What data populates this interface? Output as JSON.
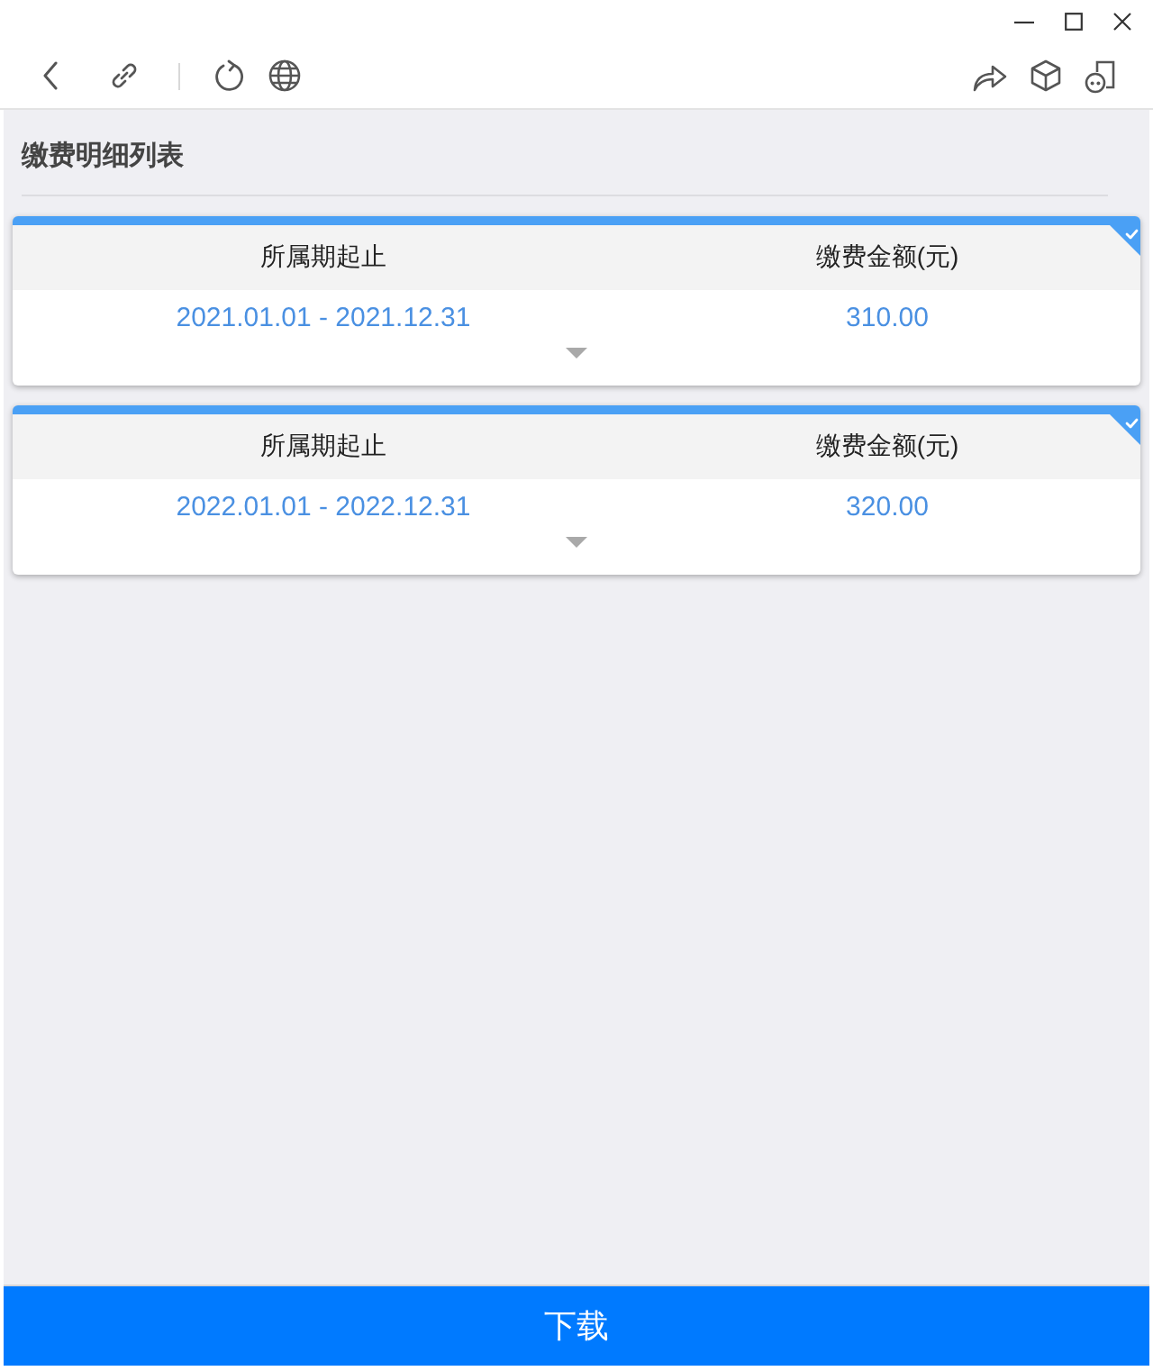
{
  "page_title": "缴费明细列表",
  "records": [
    {
      "selected": true,
      "period_label": "所属期起止",
      "amount_label": "缴费金额(元)",
      "period": "2021.01.01 - 2021.12.31",
      "amount": "310.00"
    },
    {
      "selected": true,
      "period_label": "所属期起止",
      "amount_label": "缴费金额(元)",
      "period": "2022.01.01 - 2022.12.31",
      "amount": "320.00"
    }
  ],
  "download_button": "下载"
}
